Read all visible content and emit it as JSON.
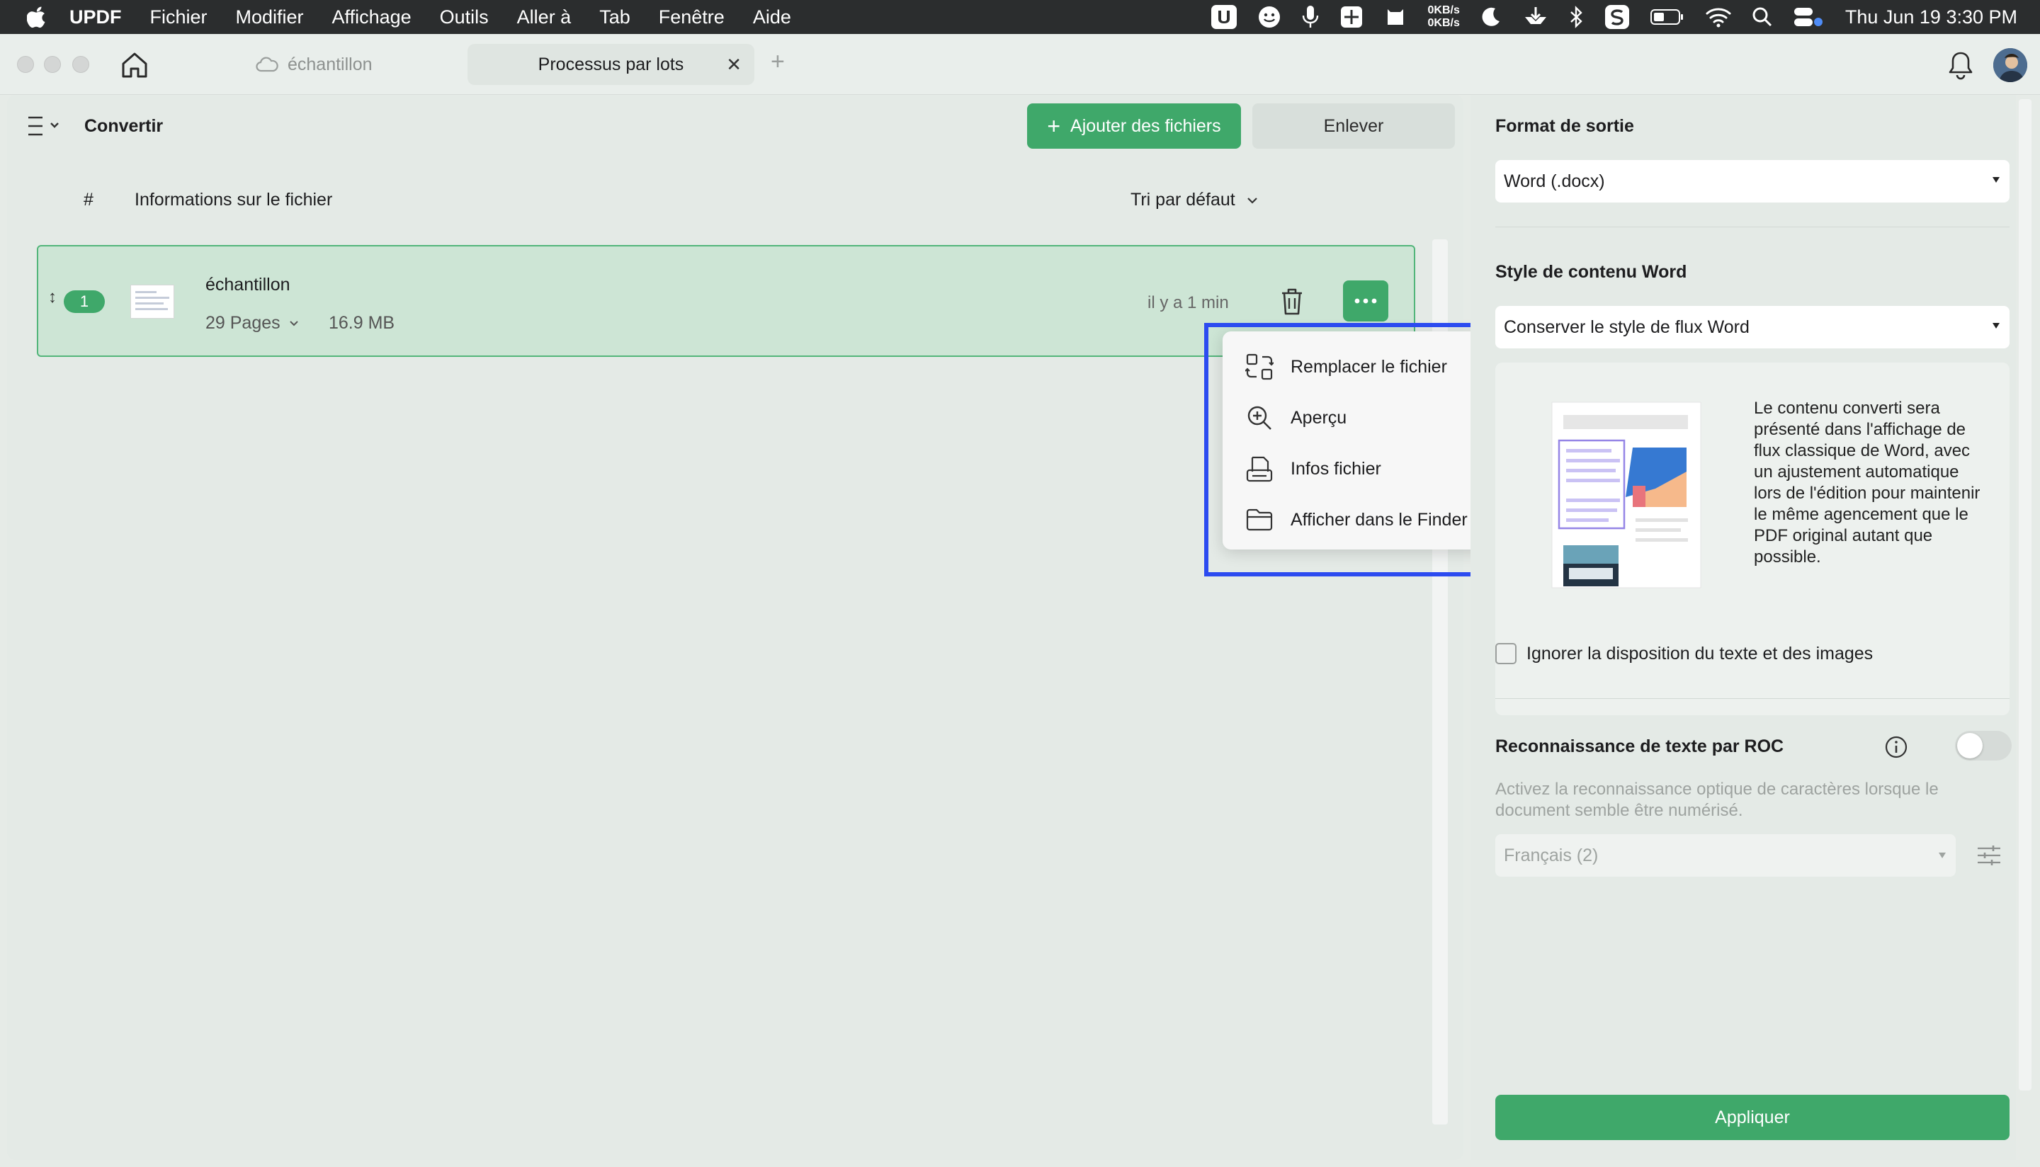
{
  "menubar": {
    "app_name": "UPDF",
    "items": [
      "Fichier",
      "Modifier",
      "Affichage",
      "Outils",
      "Aller à",
      "Tab",
      "Fenêtre",
      "Aide"
    ],
    "net_up": "0KB/s",
    "net_down": "0KB/s",
    "clock": "Thu Jun 19  3:30 PM"
  },
  "tabs": [
    {
      "label": "échantillon",
      "active": false
    },
    {
      "label": "Processus par lots",
      "active": true
    }
  ],
  "toolbar": {
    "title": "Convertir",
    "add_label": "Ajouter des fichiers",
    "remove_label": "Enlever"
  },
  "list": {
    "col_hash": "#",
    "col_info": "Informations sur le fichier",
    "sort_label": "Tri par défaut",
    "files": [
      {
        "index": "1",
        "name": "échantillon",
        "pages": "29 Pages",
        "size": "16.9 MB",
        "time": "il y a 1 min"
      }
    ]
  },
  "context_menu": {
    "items": [
      {
        "label": "Remplacer le fichier",
        "icon": "replace-icon"
      },
      {
        "label": "Aperçu",
        "icon": "zoom-icon"
      },
      {
        "label": "Infos fichier",
        "icon": "file-info-icon"
      },
      {
        "label": "Afficher dans le Finder",
        "icon": "folder-icon"
      }
    ]
  },
  "settings": {
    "output_format_label": "Format de sortie",
    "output_format_value": "Word (.docx)",
    "word_style_label": "Style de contenu Word",
    "word_style_value": "Conserver le style de flux Word",
    "word_style_description": "Le contenu converti sera présenté dans l'affichage de flux classique de Word, avec un ajustement automatique lors de l'édition pour maintenir le même agencement que le PDF original autant que possible.",
    "ignore_layout_label": "Ignorer la disposition du texte et des images",
    "ocr_label": "Reconnaissance de texte par ROC",
    "ocr_description": "Activez la reconnaissance optique de caractères lorsque le document semble être numérisé.",
    "ocr_language": "Français (2)",
    "apply_label": "Appliquer"
  },
  "colors": {
    "accent": "#3fa86a",
    "highlight": "#2c4bf0"
  }
}
